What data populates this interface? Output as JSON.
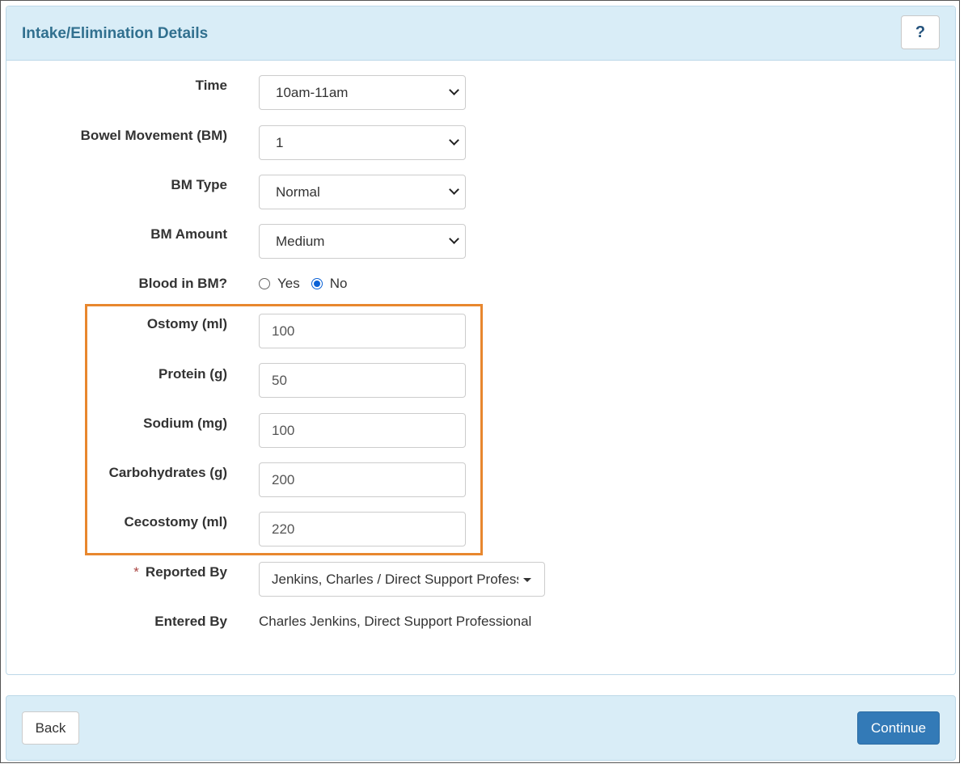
{
  "header": {
    "title": "Intake/Elimination Details",
    "help_label": "?"
  },
  "fields": {
    "time": {
      "label": "Time",
      "value": "10am-11am"
    },
    "bowel_movement": {
      "label": "Bowel Movement (BM)",
      "value": "1"
    },
    "bm_type": {
      "label": "BM Type",
      "value": "Normal"
    },
    "bm_amount": {
      "label": "BM Amount",
      "value": "Medium"
    },
    "blood_in_bm": {
      "label": "Blood in BM?",
      "option_yes": "Yes",
      "option_no": "No",
      "selected": "No"
    },
    "ostomy": {
      "label": "Ostomy (ml)",
      "value": "100"
    },
    "protein": {
      "label": "Protein (g)",
      "value": "50"
    },
    "sodium": {
      "label": "Sodium (mg)",
      "value": "100"
    },
    "carbohydrates": {
      "label": "Carbohydrates (g)",
      "value": "200"
    },
    "cecostomy": {
      "label": "Cecostomy (ml)",
      "value": "220"
    },
    "reported_by": {
      "required_mark": "*",
      "label": "Reported By",
      "value": "Jenkins, Charles / Direct Support Professional"
    },
    "entered_by": {
      "label": "Entered By",
      "value": "Charles Jenkins, Direct Support Professional"
    }
  },
  "footer": {
    "back_label": "Back",
    "continue_label": "Continue"
  },
  "colors": {
    "header_bg": "#d9edf7",
    "title": "#31708f",
    "highlight_border": "#e8872e",
    "primary_button": "#337ab7"
  }
}
